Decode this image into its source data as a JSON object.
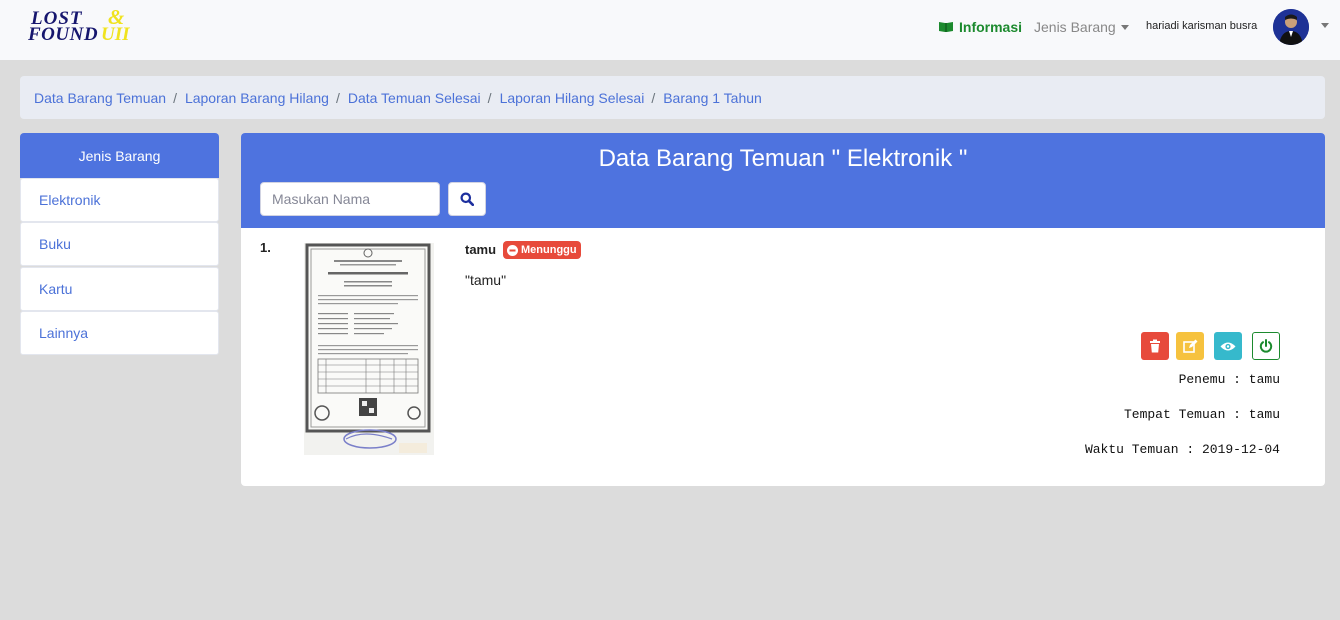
{
  "navbar": {
    "logo_line1": "LOST",
    "logo_amp": "&",
    "logo_line2": "FOUND",
    "logo_uii": "UII",
    "info_label": "Informasi",
    "jenis_label": "Jenis Barang",
    "user_name": "hariadi karisman busra"
  },
  "breadcrumb": [
    "Data Barang Temuan",
    "Laporan Barang Hilang",
    "Data Temuan Selesai",
    "Laporan Hilang Selesai",
    "Barang 1 Tahun"
  ],
  "sidebar": {
    "title": "Jenis Barang",
    "items": [
      "Elektronik",
      "Buku",
      "Kartu",
      "Lainnya"
    ]
  },
  "main": {
    "title": "Data Barang Temuan \" Elektronik \"",
    "search_placeholder": "Masukan Nama",
    "items": [
      {
        "number": "1.",
        "name": "tamu",
        "status": "Menunggu",
        "description": "\"tamu\"",
        "penemu": "Penemu : tamu",
        "tempat": "Tempat Temuan : tamu",
        "waktu": "Waktu Temuan : 2019-12-04"
      }
    ]
  },
  "colors": {
    "primary": "#4e73df",
    "danger": "#e74a3b",
    "warning": "#f6c23e",
    "info": "#36b9cc",
    "success": "#1c8a2e"
  }
}
